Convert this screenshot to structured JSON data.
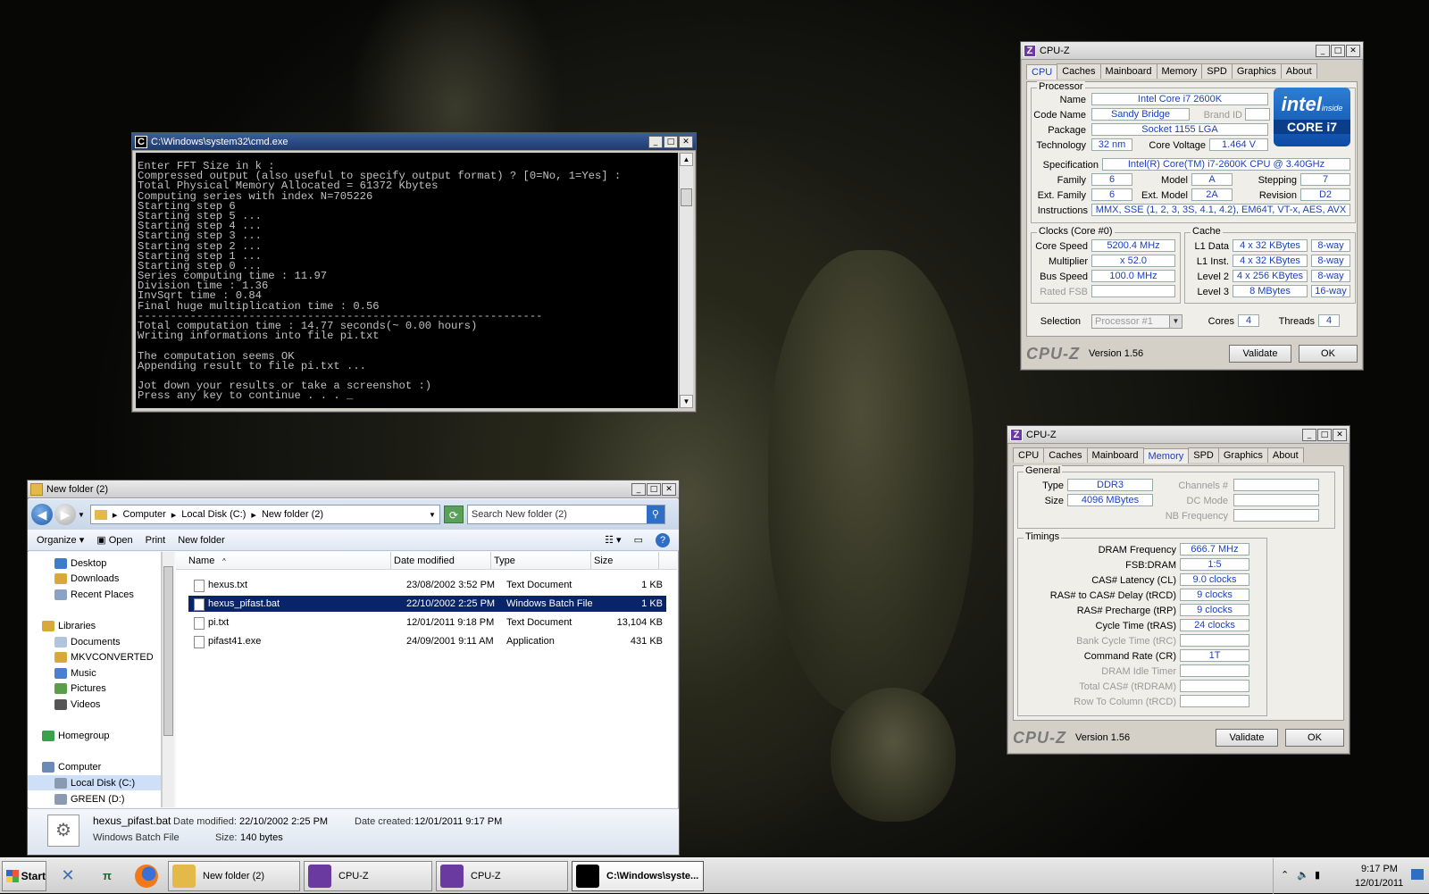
{
  "cmd": {
    "title": "C:\\Windows\\system32\\cmd.exe",
    "lines": [
      "Enter FFT Size in k :",
      "Compressed output (also useful to specify output format) ? [0=No, 1=Yes] :",
      "Total Physical Memory Allocated = 61372 Kbytes",
      "Computing series with index N=705226",
      "Starting step 6",
      "Starting step 5 ...",
      "Starting step 4 ...",
      "Starting step 3 ...",
      "Starting step 2 ...",
      "Starting step 1 ...",
      "Starting step 0 ...",
      "Series computing time : 11.97",
      "Division time : 1.36",
      "InvSqrt time : 0.84",
      "Final huge multiplication time : 0.56",
      "--------------------------------------------------------------",
      "Total computation time : 14.77 seconds(~ 0.00 hours)",
      "Writing informations into file pi.txt",
      "",
      "The computation seems OK",
      "Appending result to file pi.txt ...",
      "",
      "Jot down your results or take a screenshot :)",
      "Press any key to continue . . . _"
    ]
  },
  "cpuz_cpu": {
    "title": "CPU-Z",
    "tabs": [
      "CPU",
      "Caches",
      "Mainboard",
      "Memory",
      "SPD",
      "Graphics",
      "About"
    ],
    "active_tab": "CPU",
    "processor_label": "Processor",
    "name_label": "Name",
    "name": "Intel Core i7 2600K",
    "codename_label": "Code Name",
    "codename": "Sandy Bridge",
    "brandid_label": "Brand ID",
    "package_label": "Package",
    "package": "Socket 1155 LGA",
    "technology_label": "Technology",
    "technology": "32 nm",
    "corevoltage_label": "Core Voltage",
    "corevoltage": "1.464 V",
    "specification_label": "Specification",
    "specification": "Intel(R) Core(TM) i7-2600K CPU @ 3.40GHz",
    "family_label": "Family",
    "family": "6",
    "model_label": "Model",
    "model": "A",
    "stepping_label": "Stepping",
    "stepping": "7",
    "extfamily_label": "Ext. Family",
    "extfamily": "6",
    "extmodel_label": "Ext. Model",
    "extmodel": "2A",
    "revision_label": "Revision",
    "revision": "D2",
    "instructions_label": "Instructions",
    "instructions": "MMX, SSE (1, 2, 3, 3S, 4.1, 4.2), EM64T, VT-x, AES, AVX",
    "clocks_label": "Clocks (Core #0)",
    "corespeed_label": "Core Speed",
    "corespeed": "5200.4 MHz",
    "multiplier_label": "Multiplier",
    "multiplier": "x 52.0",
    "busspeed_label": "Bus Speed",
    "busspeed": "100.0 MHz",
    "ratedfsb_label": "Rated FSB",
    "ratedfsb": "",
    "cache_label": "Cache",
    "l1data_label": "L1 Data",
    "l1data": "4 x 32 KBytes",
    "l1data_way": "8-way",
    "l1inst_label": "L1 Inst.",
    "l1inst": "4 x 32 KBytes",
    "l1inst_way": "8-way",
    "l2_label": "Level 2",
    "l2": "4 x 256 KBytes",
    "l2_way": "8-way",
    "l3_label": "Level 3",
    "l3": "8 MBytes",
    "l3_way": "16-way",
    "selection_label": "Selection",
    "selection": "Processor #1",
    "cores_label": "Cores",
    "cores": "4",
    "threads_label": "Threads",
    "threads": "4",
    "intel_word": "intel",
    "intel_inside": "inside",
    "intel_brand": "CORE i7",
    "logo": "CPU-Z",
    "version": "Version 1.56",
    "validate": "Validate",
    "ok": "OK"
  },
  "cpuz_mem": {
    "title": "CPU-Z",
    "tabs": [
      "CPU",
      "Caches",
      "Mainboard",
      "Memory",
      "SPD",
      "Graphics",
      "About"
    ],
    "active_tab": "Memory",
    "general_label": "General",
    "type_label": "Type",
    "type": "DDR3",
    "size_label": "Size",
    "size": "4096 MBytes",
    "channels_label": "Channels #",
    "dcmode_label": "DC Mode",
    "nbfreq_label": "NB Frequency",
    "timings_label": "Timings",
    "timings": [
      {
        "label": "DRAM Frequency",
        "value": "666.7 MHz",
        "dim": false
      },
      {
        "label": "FSB:DRAM",
        "value": "1:5",
        "dim": false
      },
      {
        "label": "CAS# Latency (CL)",
        "value": "9.0 clocks",
        "dim": false
      },
      {
        "label": "RAS# to CAS# Delay (tRCD)",
        "value": "9 clocks",
        "dim": false
      },
      {
        "label": "RAS# Precharge (tRP)",
        "value": "9 clocks",
        "dim": false
      },
      {
        "label": "Cycle Time (tRAS)",
        "value": "24 clocks",
        "dim": false
      },
      {
        "label": "Bank Cycle Time (tRC)",
        "value": "",
        "dim": true
      },
      {
        "label": "Command Rate (CR)",
        "value": "1T",
        "dim": false
      },
      {
        "label": "DRAM Idle Timer",
        "value": "",
        "dim": true
      },
      {
        "label": "Total CAS# (tRDRAM)",
        "value": "",
        "dim": true
      },
      {
        "label": "Row To Column (tRCD)",
        "value": "",
        "dim": true
      }
    ],
    "logo": "CPU-Z",
    "version": "Version 1.56",
    "validate": "Validate",
    "ok": "OK"
  },
  "explorer": {
    "title": "New folder (2)",
    "breadcrumb": [
      "Computer",
      "Local Disk (C:)",
      "New folder (2)"
    ],
    "search_placeholder": "Search New folder (2)",
    "toolbar": {
      "organize": "Organize",
      "open": "Open",
      "print": "Print",
      "new_folder": "New folder"
    },
    "nav": [
      {
        "label": "Desktop",
        "indent": 1,
        "color": "#3d7cc9",
        "sel": false
      },
      {
        "label": "Downloads",
        "indent": 1,
        "color": "#d9a83b",
        "sel": false
      },
      {
        "label": "Recent Places",
        "indent": 1,
        "color": "#8aa3c4",
        "sel": false
      },
      {
        "label": "",
        "indent": 0,
        "color": "",
        "sel": false
      },
      {
        "label": "Libraries",
        "indent": 0,
        "color": "#d9a83b",
        "sel": false
      },
      {
        "label": "Documents",
        "indent": 1,
        "color": "#b0c4de",
        "sel": false
      },
      {
        "label": "MKVCONVERTED",
        "indent": 1,
        "color": "#d9a83b",
        "sel": false
      },
      {
        "label": "Music",
        "indent": 1,
        "color": "#4a7fd0",
        "sel": false
      },
      {
        "label": "Pictures",
        "indent": 1,
        "color": "#5a9e4a",
        "sel": false
      },
      {
        "label": "Videos",
        "indent": 1,
        "color": "#555555",
        "sel": false
      },
      {
        "label": "",
        "indent": 0,
        "color": "",
        "sel": false
      },
      {
        "label": "Homegroup",
        "indent": 0,
        "color": "#3aa04a",
        "sel": false
      },
      {
        "label": "",
        "indent": 0,
        "color": "",
        "sel": false
      },
      {
        "label": "Computer",
        "indent": 0,
        "color": "#6a8bb4",
        "sel": false
      },
      {
        "label": "Local Disk (C:)",
        "indent": 1,
        "color": "#8a9ab0",
        "sel": true
      },
      {
        "label": "GREEN (D:)",
        "indent": 1,
        "color": "#8a9ab0",
        "sel": false
      }
    ],
    "columns": {
      "name": "Name",
      "modified": "Date modified",
      "type": "Type",
      "size": "Size"
    },
    "files": [
      {
        "name": "hexus.txt",
        "modified": "23/08/2002 3:52 PM",
        "type": "Text Document",
        "size": "1 KB",
        "sel": false
      },
      {
        "name": "hexus_pifast.bat",
        "modified": "22/10/2002 2:25 PM",
        "type": "Windows Batch File",
        "size": "1 KB",
        "sel": true
      },
      {
        "name": "pi.txt",
        "modified": "12/01/2011 9:18 PM",
        "type": "Text Document",
        "size": "13,104 KB",
        "sel": false
      },
      {
        "name": "pifast41.exe",
        "modified": "24/09/2001 9:11 AM",
        "type": "Application",
        "size": "431 KB",
        "sel": false
      }
    ],
    "details": {
      "name": "hexus_pifast.bat",
      "modified_label": "Date modified:",
      "modified": "22/10/2002 2:25 PM",
      "created_label": "Date created:",
      "created": "12/01/2011 9:17 PM",
      "type": "Windows Batch File",
      "size_label": "Size:",
      "size": "140 bytes"
    }
  },
  "taskbar": {
    "start": "Start",
    "items": [
      {
        "label": "New folder (2)",
        "active": false
      },
      {
        "label": "CPU-Z",
        "active": false
      },
      {
        "label": "CPU-Z",
        "active": false
      },
      {
        "label": "C:\\Windows\\syste...",
        "active": true
      }
    ],
    "time": "9:17 PM",
    "date": "12/01/2011"
  }
}
